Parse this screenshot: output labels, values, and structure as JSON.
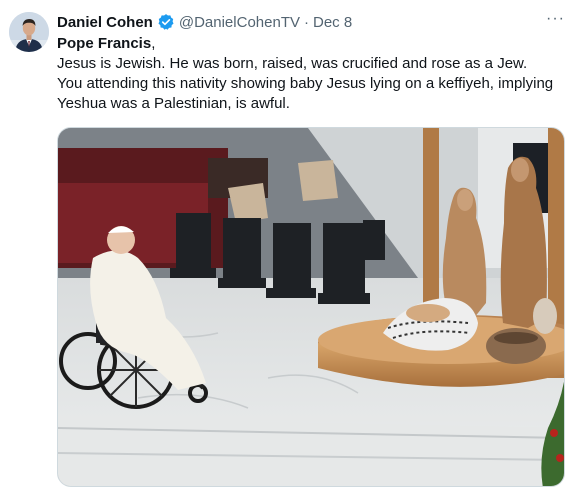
{
  "author": {
    "name": "Daniel Cohen",
    "handle": "@DanielCohenTV",
    "separator": "·",
    "date": "Dec 8",
    "verified": true
  },
  "tweet": {
    "mention": "Pope Francis",
    "mention_suffix": ",",
    "line1": "Jesus is Jewish. He was born, raised, was crucified and rose as a Jew.",
    "line2": "You attending this nativity showing baby Jesus lying on a keffiyeh, implying Yeshua was a Palestinian, is awful."
  },
  "more_menu": "···",
  "colors": {
    "text": "#0f1419",
    "secondary": "#536471",
    "verified": "#1d9bf0",
    "border": "#cfd9de"
  },
  "icons": {
    "verified": "verified-badge-icon",
    "more": "more-options-icon"
  }
}
